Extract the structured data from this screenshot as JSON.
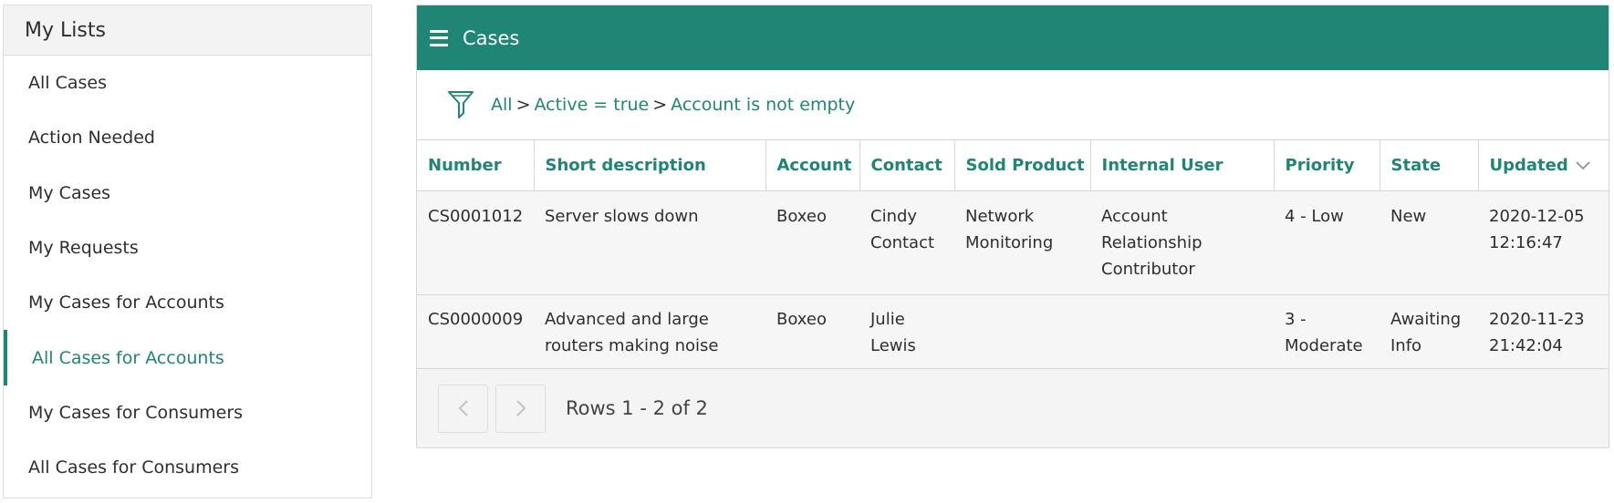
{
  "sidebar": {
    "title": "My Lists",
    "items": [
      {
        "label": "All Cases"
      },
      {
        "label": "Action Needed"
      },
      {
        "label": "My Cases"
      },
      {
        "label": "My Requests"
      },
      {
        "label": "My Cases for Accounts"
      },
      {
        "label": "All Cases for Accounts"
      },
      {
        "label": "My Cases for Consumers"
      },
      {
        "label": "All Cases for Consumers"
      }
    ],
    "active_index": 5
  },
  "panel": {
    "title": "Cases",
    "breadcrumb": {
      "all": "All",
      "sep": ">",
      "condition1": "Active = true",
      "condition2": "Account is not empty"
    },
    "table": {
      "headers": [
        "Number",
        "Short description",
        "Account",
        "Contact",
        "Sold Product",
        "Internal User",
        "Priority",
        "State",
        "Updated"
      ],
      "rows": [
        [
          "CS0001012",
          "Server slows down",
          "Boxeo",
          "Cindy Contact",
          "Network Monitoring",
          "Account Relationship Contributor",
          "4 - Low",
          "New",
          "2020-12-05 12:16:47"
        ],
        [
          "CS0000009",
          "Advanced and large routers making noise",
          "Boxeo",
          "Julie Lewis",
          "",
          "",
          "3 - Moderate",
          "Awaiting Info",
          "2020-11-23 21:42:04"
        ]
      ]
    },
    "pager": {
      "text": "Rows 1 - 2 of 2"
    }
  },
  "colors": {
    "accent": "#1f8575",
    "header_bg": "#1f8575",
    "row_bg": "#f6f6f6"
  },
  "icons": [
    "hamburger-icon",
    "filter-icon",
    "sort-down-icon",
    "chevron-left-icon",
    "chevron-right-icon"
  ]
}
